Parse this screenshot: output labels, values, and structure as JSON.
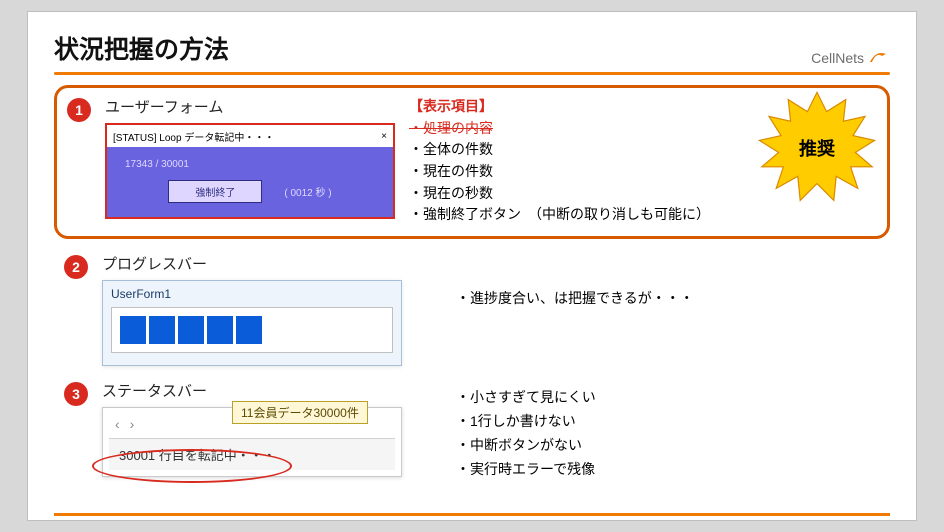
{
  "title": "状況把握の方法",
  "logo_text": "CellNets",
  "section1": {
    "num": "1",
    "label": "ユーザーフォーム",
    "uf_title": "[STATUS] Loop データ転記中・・・",
    "uf_close": "×",
    "uf_count": "17343 / 30001",
    "uf_btn": "強制終了",
    "uf_timer": "( 0012 秒 )",
    "right_head": "【表示項目】",
    "bullets": {
      "b1": "処理の内容",
      "b2": "全体の件数",
      "b3": "現在の件数",
      "b4": "現在の秒数",
      "b5": "強制終了ボタン　（中断の取り消しも可能に）"
    },
    "star_label": "推奨"
  },
  "section2": {
    "num": "2",
    "label": "プログレスバー",
    "pb_title": "UserForm1",
    "right": "・進捗度合い、は把握できるが・・・"
  },
  "section3": {
    "num": "3",
    "label": "ステータスバー",
    "tooltip": "11会員データ30000件",
    "nav_prev": "‹",
    "nav_next": "›",
    "status_text": "30001 行目を転記中・・・",
    "bullets": {
      "b1": "小さすぎて見にくい",
      "b2": "1行しか書けない",
      "b3": "中断ボタンがない",
      "b4": "実行時エラーで残像"
    }
  }
}
